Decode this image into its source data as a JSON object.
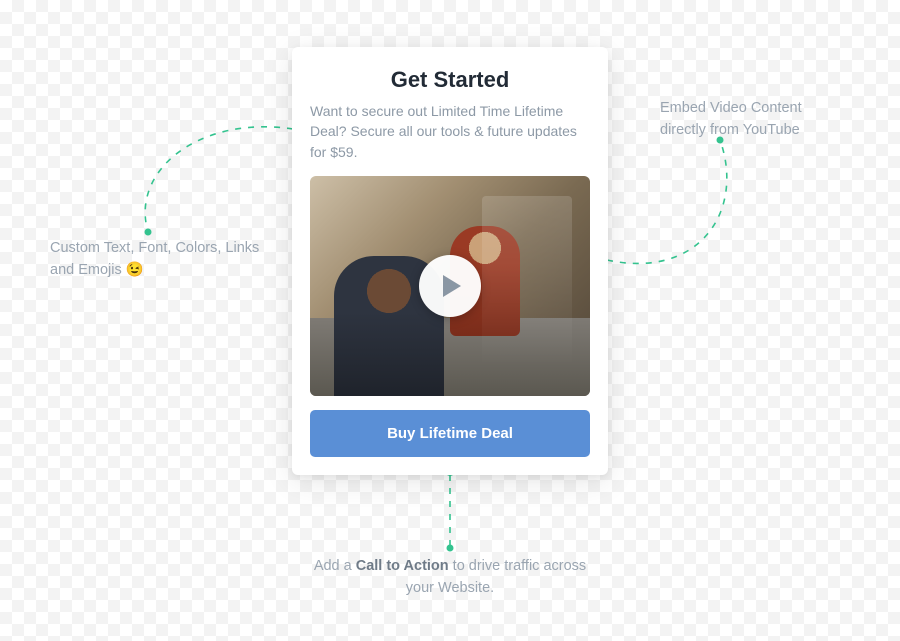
{
  "card": {
    "title": "Get Started",
    "description": "Want to secure out Limited Time Lifetime Deal? Secure all our tools & future updates for $59.",
    "cta_label": "Buy Lifetime Deal"
  },
  "annotations": {
    "left_text": "Custom Text, Font, Colors, Links and Emojis 😉",
    "right_text": "Embed Video Content directly from YouTube",
    "bottom_prefix": "Add a ",
    "bottom_bold": "Call to Action",
    "bottom_suffix": " to drive traffic across your Website."
  },
  "colors": {
    "accent_green": "#34c38f",
    "cta_blue": "#5a8fd6"
  }
}
